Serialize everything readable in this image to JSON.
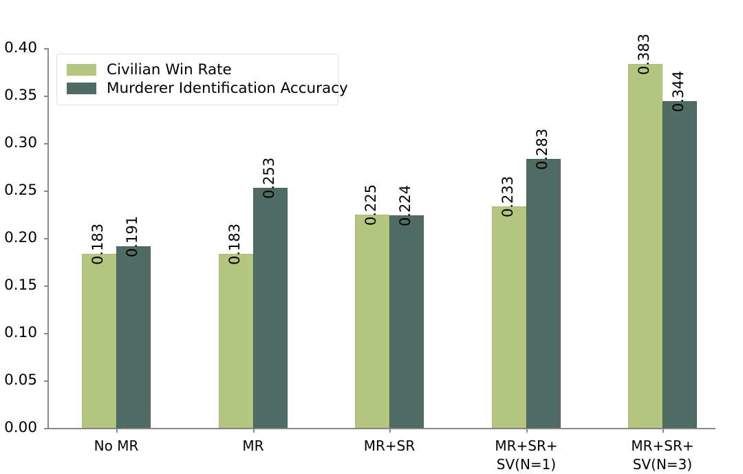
{
  "chart_data": {
    "type": "bar",
    "title": "",
    "subtitle": "",
    "xlabel": "",
    "ylabel": "",
    "ylim": [
      0.0,
      0.4
    ],
    "yticks": [
      "0.00",
      "0.05",
      "0.10",
      "0.15",
      "0.20",
      "0.25",
      "0.30",
      "0.35",
      "0.40"
    ],
    "ytick_values": [
      0.0,
      0.05,
      0.1,
      0.15,
      0.2,
      0.25,
      0.3,
      0.35,
      0.4
    ],
    "grid": false,
    "legend_position": "upper left",
    "bar_label_rotation": 90,
    "categories": [
      "No MR",
      "MR",
      "MR+SR",
      "MR+SR+\nSV(N=1)",
      "MR+SR+\nSV(N=3)"
    ],
    "series": [
      {
        "name": "Civilian Win Rate",
        "color": "#b4c680",
        "values": [
          0.183,
          0.183,
          0.225,
          0.233,
          0.383
        ],
        "labels": [
          "0.183",
          "0.183",
          "0.225",
          "0.233",
          "0.383"
        ]
      },
      {
        "name": "Murderer Identification Accuracy",
        "color": "#506b63",
        "values": [
          0.191,
          0.253,
          0.224,
          0.283,
          0.344
        ],
        "labels": [
          "0.191",
          "0.253",
          "0.224",
          "0.283",
          "0.344"
        ]
      }
    ]
  },
  "legend": {
    "items": [
      {
        "label": "Civilian Win Rate",
        "color": "#b4c680"
      },
      {
        "label": "Murderer Identification Accuracy",
        "color": "#506b63"
      }
    ]
  },
  "colors": {
    "series_light": "#b4c680",
    "series_dark": "#506b63",
    "axis": "#888888",
    "text": "#000000",
    "background": "#ffffff"
  }
}
